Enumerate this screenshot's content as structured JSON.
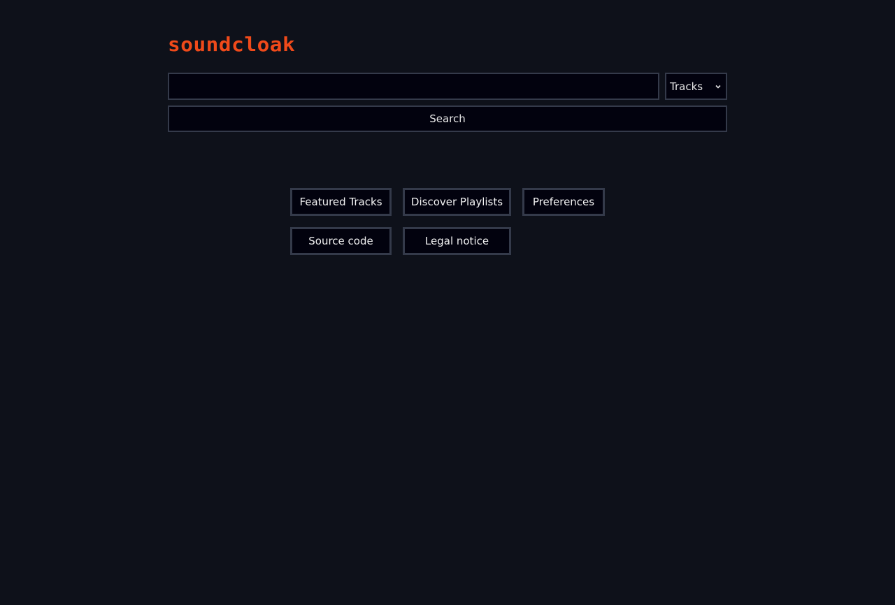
{
  "logo": {
    "text": "soundcloak"
  },
  "search": {
    "query": "",
    "placeholder": "",
    "type_selected": "Tracks",
    "button_label": "Search"
  },
  "nav": {
    "featured_tracks": "Featured Tracks",
    "discover_playlists": "Discover Playlists",
    "preferences": "Preferences",
    "source_code": "Source code",
    "legal_notice": "Legal notice"
  },
  "colors": {
    "background": "#0e111a",
    "accent": "#f04a1a",
    "control_bg": "#02020e",
    "control_border": "#343a4a"
  }
}
